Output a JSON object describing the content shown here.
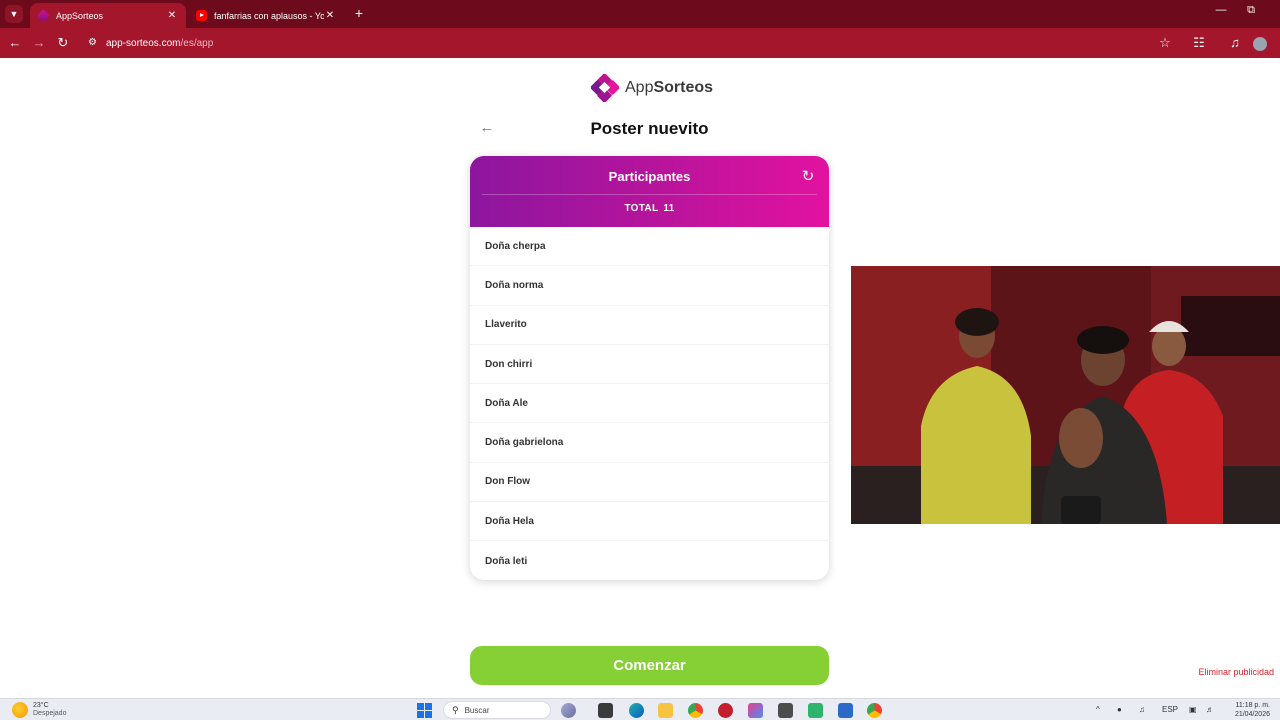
{
  "browser": {
    "tabs": [
      {
        "title": "AppSorteos",
        "active": true
      },
      {
        "title": "fanfarrias con aplausos - YouTube",
        "active": false
      }
    ],
    "address": {
      "host": "app-sorteos.com",
      "path": "/es/app"
    }
  },
  "app": {
    "logo": {
      "brand_regular": "App",
      "brand_bold": "Sorteos"
    },
    "page_title": "Poster nuevito",
    "card": {
      "title": "Participantes",
      "total_label": "TOTAL",
      "total_count": "11"
    },
    "participants": [
      "Doña cherpa",
      "Doña norma",
      "Llaverito",
      "Don chirri",
      "Doña Ale",
      "Doña gabrielona",
      "Don Flow",
      "Doña Hela",
      "Doña leti"
    ],
    "start_button": "Comenzar",
    "remove_ads": "Eliminar publicidad"
  },
  "taskbar": {
    "weather": {
      "temp": "23°C",
      "condition": "Despejado"
    },
    "search_placeholder": "Buscar",
    "language": "ESP",
    "time": "11:18 p. m.",
    "date": "21/04/2026"
  },
  "colors": {
    "chrome_dark": "#6d0a1b",
    "chrome": "#a3162c",
    "card_gradient_start": "#8d169f",
    "card_gradient_end": "#e312a0",
    "start_button": "#86cf35"
  }
}
